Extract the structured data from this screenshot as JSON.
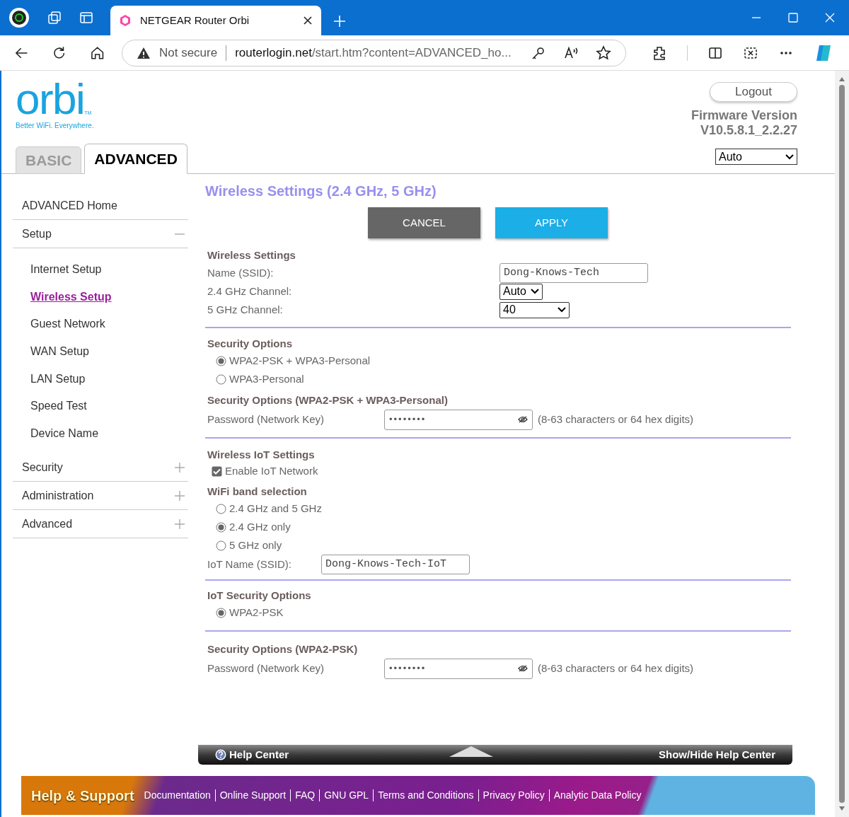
{
  "browser": {
    "tab_title": "NETGEAR Router Orbi",
    "security_label": "Not secure",
    "url_host": "routerlogin.net",
    "url_path": "/start.htm?content=ADVANCED_ho..."
  },
  "header": {
    "logo": "orbi",
    "logo_mark": "TM",
    "tagline": "Better WiFi. Everywhere.",
    "logout": "Logout",
    "firmware_label": "Firmware Version",
    "firmware_version": "V10.5.8.1_2.2.27",
    "language": "Auto"
  },
  "tabs": [
    {
      "label": "BASIC",
      "selected": false
    },
    {
      "label": "ADVANCED",
      "selected": true
    }
  ],
  "sidebar": {
    "items": [
      {
        "label": "ADVANCED Home",
        "kind": "link"
      },
      {
        "label": "Setup",
        "kind": "group",
        "expanded": true,
        "children": [
          {
            "label": "Internet Setup",
            "selected": false
          },
          {
            "label": "Wireless Setup",
            "selected": true
          },
          {
            "label": "Guest Network",
            "selected": false
          },
          {
            "label": "WAN Setup",
            "selected": false
          },
          {
            "label": "LAN Setup",
            "selected": false
          },
          {
            "label": "Speed Test",
            "selected": false
          },
          {
            "label": "Device Name",
            "selected": false
          }
        ]
      },
      {
        "label": "Security",
        "kind": "group",
        "expanded": false
      },
      {
        "label": "Administration",
        "kind": "group",
        "expanded": false
      },
      {
        "label": "Advanced",
        "kind": "group",
        "expanded": false
      }
    ]
  },
  "page_title": "Wireless Settings (2.4 GHz, 5 GHz)",
  "buttons": [
    {
      "label": "CANCEL",
      "kind": "cancel"
    },
    {
      "label": "APPLY",
      "kind": "apply"
    }
  ],
  "sections": [
    {
      "rows": [
        {
          "kind": "heading",
          "label": "Wireless Settings"
        },
        {
          "kind": "field",
          "label": "Name (SSID):",
          "value": "Dong-Knows-Tech"
        },
        {
          "kind": "select",
          "label": "2.4 GHz Channel:",
          "value": "Auto"
        },
        {
          "kind": "select",
          "label": "5 GHz Channel:",
          "value": "40"
        }
      ]
    },
    {
      "rows": [
        {
          "kind": "heading",
          "label": "Security Options"
        },
        {
          "kind": "radio",
          "label": "WPA2-PSK + WPA3-Personal",
          "selected": true
        },
        {
          "kind": "radio",
          "label": "WPA3-Personal",
          "selected": false
        },
        {
          "kind": "heading",
          "label": "Security Options (WPA2-PSK + WPA3-Personal)"
        },
        {
          "kind": "password",
          "label": "Password (Network Key)",
          "value": "••••••••",
          "hint": "(8-63 characters or 64 hex digits)"
        }
      ]
    },
    {
      "rows": [
        {
          "kind": "heading",
          "label": "Wireless IoT Settings"
        },
        {
          "kind": "checkbox",
          "label": "Enable IoT Network",
          "checked": true
        },
        {
          "kind": "heading",
          "label": "WiFi band selection"
        },
        {
          "kind": "radio",
          "label": "2.4 GHz and 5 GHz",
          "selected": false
        },
        {
          "kind": "radio",
          "label": "2.4 GHz only",
          "selected": true
        },
        {
          "kind": "radio",
          "label": "5 GHz only",
          "selected": false
        },
        {
          "kind": "field",
          "label": "IoT Name (SSID):",
          "value": "Dong-Knows-Tech-IoT"
        }
      ]
    },
    {
      "rows": [
        {
          "kind": "heading",
          "label": "IoT Security Options"
        },
        {
          "kind": "radio",
          "label": "WPA2-PSK",
          "selected": true
        }
      ]
    },
    {
      "rows": [
        {
          "kind": "heading",
          "label": "Security Options (WPA2-PSK)"
        },
        {
          "kind": "password",
          "label": "Password (Network Key)",
          "value": "••••••••",
          "hint": "(8-63 characters or 64 hex digits)"
        }
      ]
    }
  ],
  "help_bar": {
    "title": "Help Center",
    "toggle": "Show/Hide Help Center"
  },
  "footer": {
    "title": "Help & Support",
    "links": [
      "Documentation",
      "Online Support",
      "FAQ",
      "GNU GPL",
      "Terms and Conditions",
      "Privacy Policy",
      "Analytic Data Policy"
    ]
  }
}
